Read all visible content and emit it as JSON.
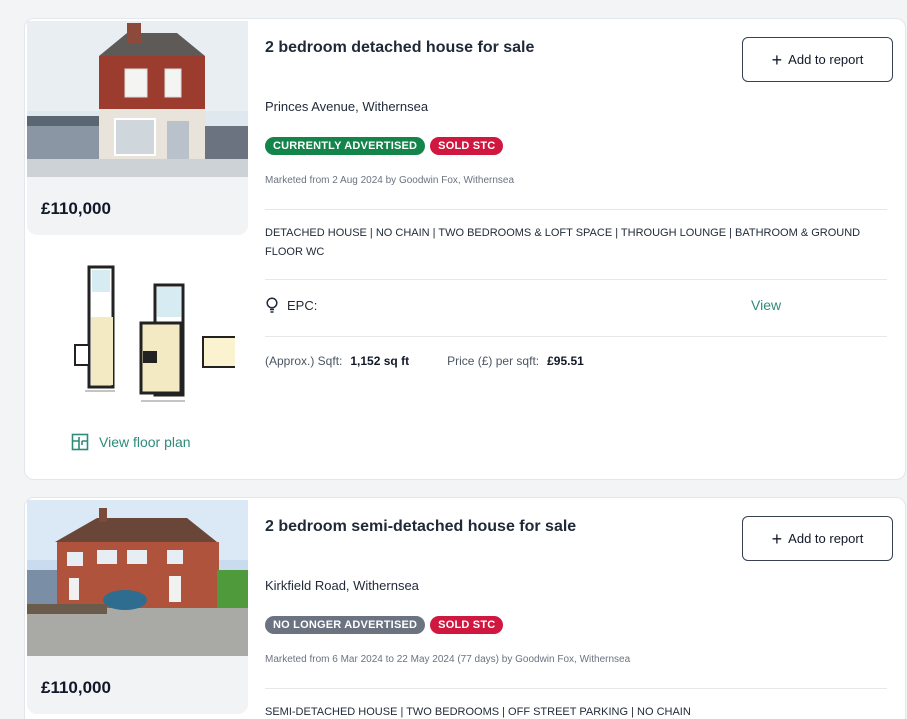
{
  "listings": [
    {
      "title": "2 bedroom detached house for sale",
      "price": "£110,000",
      "add_label": "Add to report",
      "address": "Princes Avenue, Withernsea",
      "badges": [
        {
          "label": "CURRENTLY ADVERTISED",
          "color": "#13844a"
        },
        {
          "label": "SOLD STC",
          "color": "#d0173f"
        }
      ],
      "marketed": "Marketed from 2 Aug 2024 by Goodwin Fox, Withernsea",
      "features": "DETACHED HOUSE | NO CHAIN | TWO BEDROOMS & LOFT SPACE | THROUGH LOUNGE | BATHROOM & GROUND FLOOR WC",
      "epc_label": "EPC:",
      "epc_link": "View",
      "sqft_label": "(Approx.) Sqft:",
      "sqft_value": "1,152 sq ft",
      "ppsf_label": "Price (£) per sqft:",
      "ppsf_value": "£95.51",
      "floor_plan_link": "View floor plan"
    },
    {
      "title": "2 bedroom semi-detached house for sale",
      "price": "£110,000",
      "add_label": "Add to report",
      "address": "Kirkfield Road, Withernsea",
      "badges": [
        {
          "label": "NO LONGER ADVERTISED",
          "color": "#6b7280"
        },
        {
          "label": "SOLD STC",
          "color": "#d0173f"
        }
      ],
      "marketed": "Marketed from 6 Mar 2024 to 22 May 2024 (77 days) by Goodwin Fox, Withernsea",
      "features": "SEMI-DETACHED HOUSE | TWO BEDROOMS | OFF STREET PARKING | NO CHAIN"
    }
  ],
  "colors": {
    "accent_teal": "#2e8b7a",
    "badge_green": "#13844a",
    "badge_red": "#d0173f",
    "badge_grey": "#6b7280"
  },
  "icons": [
    "plus-icon",
    "lightbulb-icon",
    "floor-plan-icon"
  ]
}
